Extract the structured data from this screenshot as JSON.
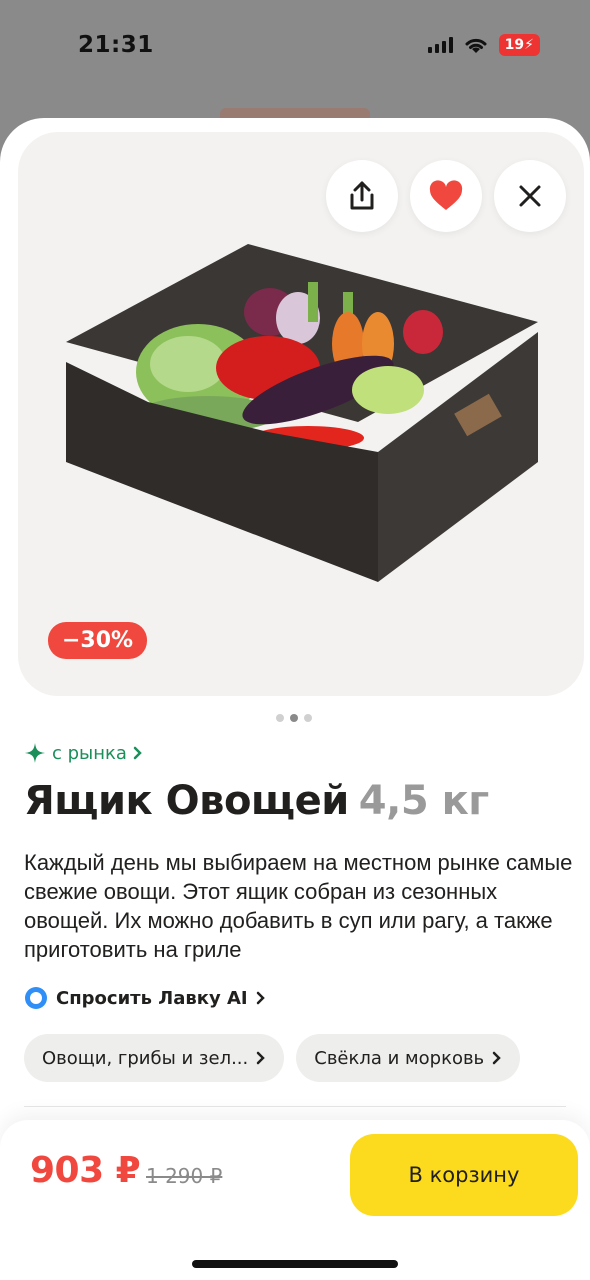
{
  "status_bar": {
    "time": "21:31",
    "battery": "19"
  },
  "header_buttons": {
    "share_icon": "share-icon",
    "favorite_icon": "heart-icon",
    "close_icon": "close-icon"
  },
  "product": {
    "discount_badge": "−30%",
    "market_link": "с рынка",
    "name": "Ящик Овощей",
    "weight": "4,5 кг",
    "description": "Каждый день мы выбираем на местном рынке самые свежие овощи. Этот ящик собран из сезонных овощей. Их можно добавить в суп или рагу, а также приготовить на гриле",
    "ask_ai_label": "Спросить Лавку AI",
    "categories": [
      "Овощи, грибы и зел...",
      "Свёкла и морковь"
    ]
  },
  "carousel": {
    "total": 3,
    "active_index": 1
  },
  "purchase": {
    "price_now": "903 ₽",
    "price_old": "1 290 ₽",
    "cart_button_label": "В корзину"
  },
  "colors": {
    "accent_red": "#f0483e",
    "cart_yellow": "#fcdb1e",
    "market_green": "#1a8f5a",
    "heart": "#f0483e"
  }
}
